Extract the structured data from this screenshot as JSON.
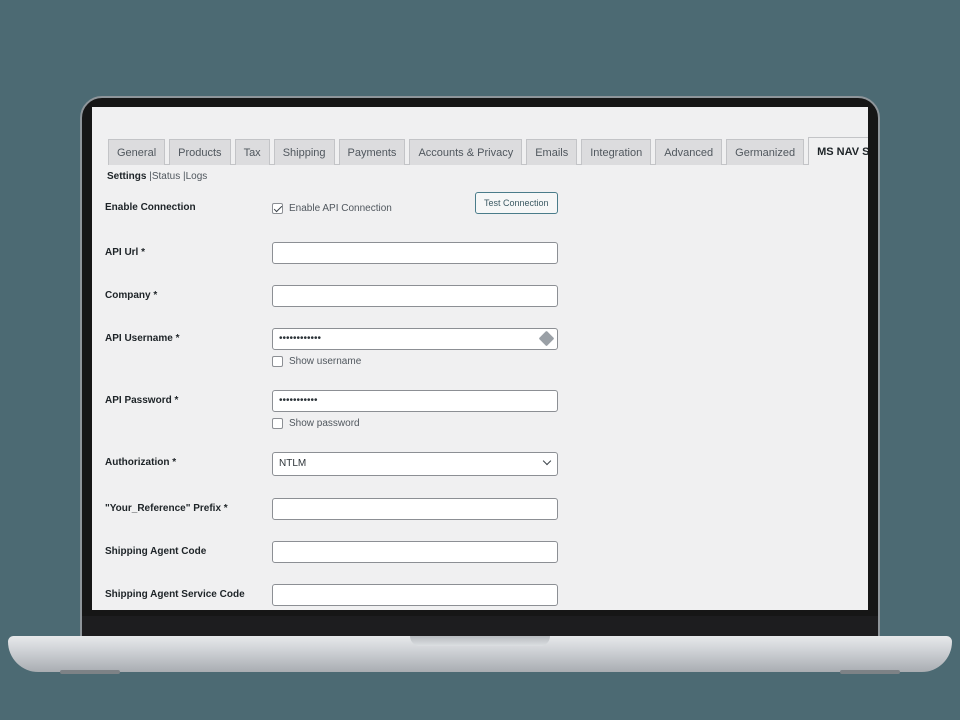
{
  "tabs": [
    {
      "label": "General"
    },
    {
      "label": "Products"
    },
    {
      "label": "Tax"
    },
    {
      "label": "Shipping"
    },
    {
      "label": "Payments"
    },
    {
      "label": "Accounts & Privacy"
    },
    {
      "label": "Emails"
    },
    {
      "label": "Integration"
    },
    {
      "label": "Advanced"
    },
    {
      "label": "Germanized"
    },
    {
      "label": "MS NAV Sync",
      "active": true
    }
  ],
  "subnav": {
    "settings": "Settings",
    "status": "Status",
    "logs": "Logs",
    "sep": "|"
  },
  "form": {
    "enable_connection": {
      "label": "Enable Connection",
      "checkbox_label": "Enable API Connection",
      "checked": true,
      "button": "Test Connection"
    },
    "api_url": {
      "label": "API Url *",
      "value": ""
    },
    "company": {
      "label": "Company *",
      "value": ""
    },
    "api_username": {
      "label": "API Username *",
      "value": "••••••••••••",
      "show_label": "Show username"
    },
    "api_password": {
      "label": "API Password *",
      "value": "•••••••••••",
      "show_label": "Show password"
    },
    "authorization": {
      "label": "Authorization *",
      "value": "NTLM"
    },
    "reference_prefix": {
      "label": "\"Your_Reference\" Prefix *",
      "value": ""
    },
    "shipping_agent_code": {
      "label": "Shipping Agent Code",
      "value": ""
    },
    "shipping_agent_service_code": {
      "label": "Shipping Agent Service Code",
      "value": ""
    }
  },
  "colors": {
    "background": "#4c6a73",
    "screen": "#f0f0f1",
    "accent": "#2271b1"
  }
}
